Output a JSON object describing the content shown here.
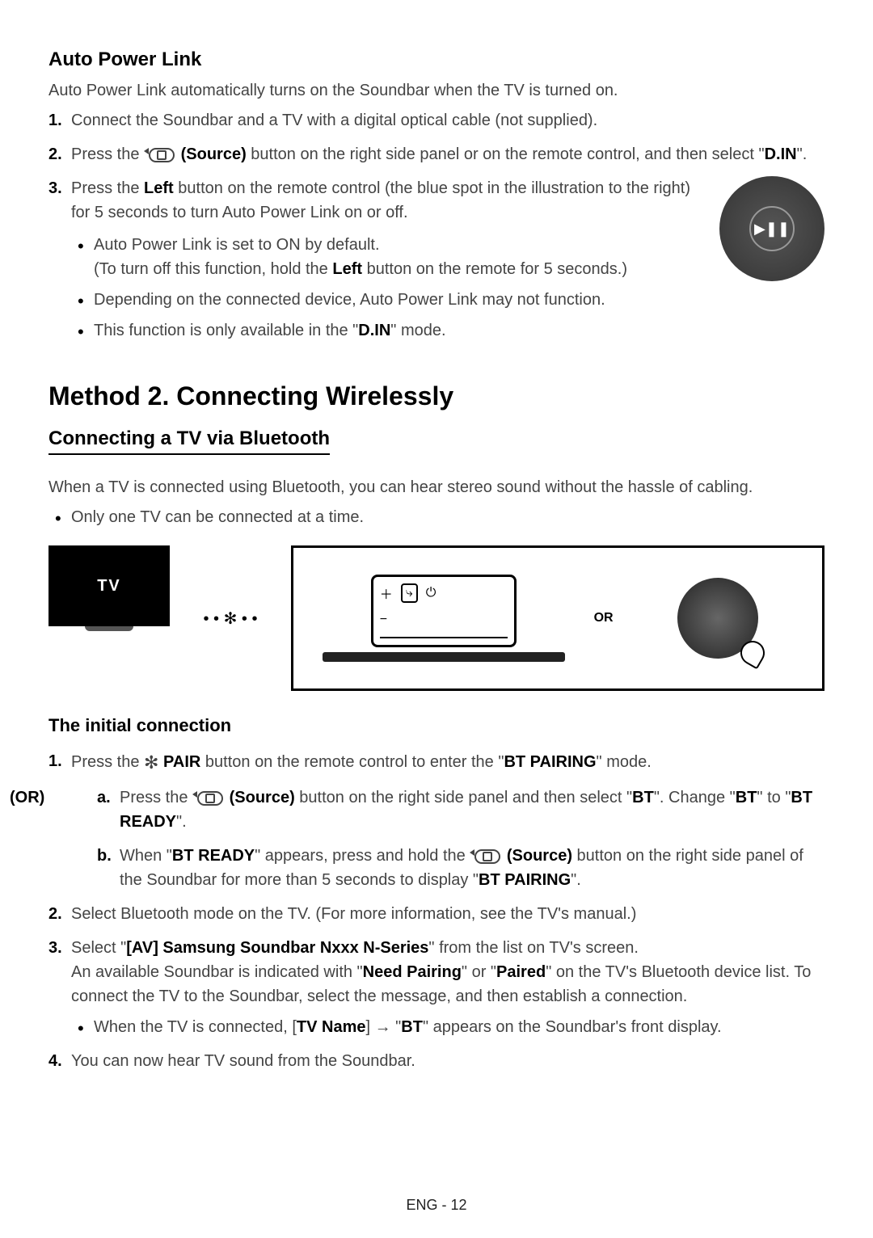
{
  "section1": {
    "title": "Auto Power Link",
    "intro": "Auto Power Link automatically turns on the Soundbar when the TV is turned on.",
    "step1": "Connect the Soundbar and a TV with a digital optical cable (not supplied).",
    "step2_a": "Press the ",
    "step2_source": "(Source)",
    "step2_b": " button on the right side panel or on the remote control, and then select \"",
    "step2_din": "D.IN",
    "step2_c": "\".",
    "step3_a": "Press the ",
    "step3_left": "Left",
    "step3_b": " button on the remote control (the blue spot in the illustration to the right) for 5 seconds to turn Auto Power Link on or off.",
    "bullet1_a": "Auto Power Link is set to ON by default.",
    "bullet1_b_a": "(To turn off this function, hold the ",
    "bullet1_b_left": "Left",
    "bullet1_b_b": " button on the remote for 5 seconds.)",
    "bullet2": "Depending on the connected device, Auto Power Link may not function.",
    "bullet3_a": "This function is only available in the \"",
    "bullet3_din": "D.IN",
    "bullet3_b": "\" mode."
  },
  "method2": {
    "title": "Method 2. Connecting Wirelessly",
    "subtitle": "Connecting a TV via Bluetooth",
    "intro": "When a TV is connected using Bluetooth, you can hear stereo sound without the hassle of cabling.",
    "bullet": "Only one TV can be connected at a time."
  },
  "diagram": {
    "tv_label": "TV",
    "or_label": "OR",
    "bt_dots": "• • ✻ • •"
  },
  "initial": {
    "title": "The initial connection",
    "step1_a": "Press the ",
    "step1_pair": " PAIR",
    "step1_b": " button on the remote control to enter the \"",
    "step1_btp": "BT PAIRING",
    "step1_c": "\" mode.",
    "or_label": "(OR)",
    "a_a": "Press the ",
    "a_source": "(Source)",
    "a_b": " button on the right side panel and then select \"",
    "a_bt": "BT",
    "a_c": "\". Change \"",
    "a_bt2": "BT",
    "a_d": "\" to \"",
    "a_btr": "BT READY",
    "a_e": "\".",
    "b_a": "When \"",
    "b_btr": "BT READY",
    "b_b": "\" appears, press and hold the ",
    "b_source": "(Source)",
    "b_c": " button on the right side panel of the Soundbar for more than 5 seconds to display \"",
    "b_btp": "BT PAIRING",
    "b_d": "\".",
    "step2": "Select Bluetooth mode on the TV. (For more information, see the TV's manual.)",
    "step3_a": "Select \"",
    "step3_av": "[AV] Samsung Soundbar Nxxx N-Series",
    "step3_b": "\" from the list on TV's screen.",
    "step3_c": "An available Soundbar is indicated with \"",
    "step3_np": "Need Pairing",
    "step3_d": "\" or \"",
    "step3_p": "Paired",
    "step3_e": "\" on the TV's Bluetooth device list. To connect the TV to the Soundbar, select the message, and then establish a connection.",
    "step3_bullet_a": "When the TV is connected, [",
    "step3_tvname": "TV Name",
    "step3_bullet_b": "] → \"",
    "step3_bt": "BT",
    "step3_bullet_c": "\" appears on the Soundbar's front display.",
    "step4": "You can now hear TV sound from the Soundbar."
  },
  "footer": "ENG - 12"
}
